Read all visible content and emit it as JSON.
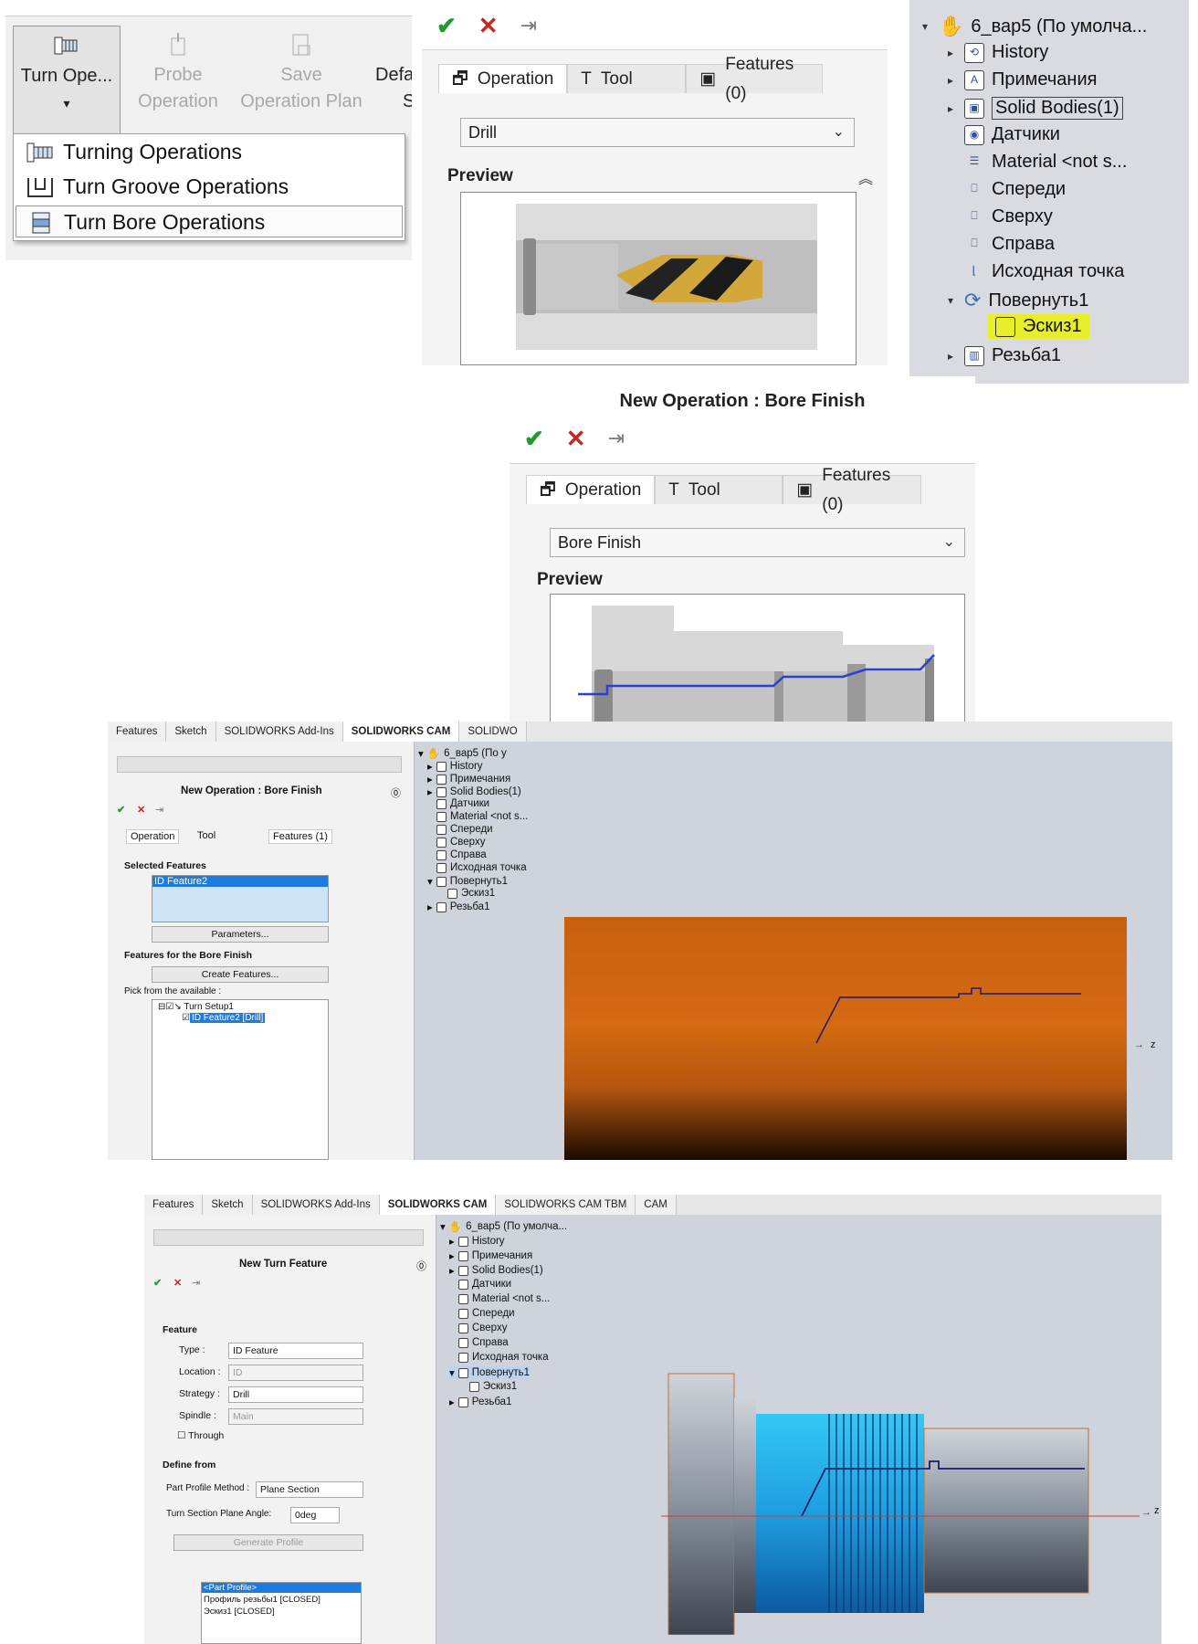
{
  "ribbon": {
    "buttons": [
      {
        "label": "Turn Ope...",
        "arrow": "▾"
      },
      {
        "label_line1": "Probe",
        "label_line2": "Operation"
      },
      {
        "label_line1": "Save",
        "label_line2": "Operation Plan"
      },
      {
        "label_line1": "Defa",
        "label_line2": "S"
      }
    ],
    "menu": [
      "Turning Operations",
      "Turn Groove Operations",
      "Turn Bore Operations"
    ]
  },
  "drill_panel": {
    "tabs": [
      "Operation",
      "Tool",
      "Features (0)"
    ],
    "select_value": "Drill",
    "preview_label": "Preview"
  },
  "tree": {
    "items": [
      "6_вар5 (По умолча...",
      "History",
      "Примечания",
      "Solid Bodies(1)",
      "Датчики",
      "Material <not s...",
      "Спереди",
      "Сверху",
      "Справа",
      "Исходная точка",
      "Повернуть1",
      "Эскиз1",
      "Резьба1"
    ]
  },
  "bore_panel": {
    "title": "New Operation : Bore Finish",
    "tabs": [
      "Operation",
      "Tool",
      "Features (0)"
    ],
    "select_value": "Bore Finish",
    "preview_label": "Preview"
  },
  "cam1": {
    "ribbon_tabs": [
      "Features",
      "Sketch",
      "SOLIDWORKS Add-Ins",
      "SOLIDWORKS CAM",
      "SOLIDWO"
    ],
    "title": "New Operation : Bore Finish",
    "tabs": [
      "Operation",
      "Tool",
      "Features (1)"
    ],
    "selected_header": "Selected Features",
    "selected_item": "ID Feature2",
    "parameters_button": "Parameters...",
    "features_header": "Features for the Bore Finish",
    "create_button": "Create Features...",
    "pick_label": "Pick from the available :",
    "setup_node": "Turn Setup1",
    "feature_node": "ID Feature2 [Drill]",
    "tree": [
      "6_вар5 (По у",
      "History",
      "Примечания",
      "Solid Bodies(1)",
      "Датчики",
      "Material <not s...",
      "Спереди",
      "Сверху",
      "Справа",
      "Исходная точка",
      "Повернуть1",
      "Эскиз1",
      "Резьба1"
    ],
    "axis_label": "z"
  },
  "cam2": {
    "ribbon_tabs": [
      "Features",
      "Sketch",
      "SOLIDWORKS Add-Ins",
      "SOLIDWORKS CAM",
      "SOLIDWORKS CAM TBM",
      "CAM"
    ],
    "title": "New Turn Feature",
    "feature_header": "Feature",
    "type_label": "Type :",
    "type_value": "ID Feature",
    "location_label": "Location :",
    "location_value": "ID",
    "strategy_label": "Strategy :",
    "strategy_value": "Drill",
    "spindle_label": "Spindle :",
    "spindle_value": "Main",
    "through_label": "Through",
    "define_header": "Define from",
    "profile_method_label": "Part Profile Method :",
    "profile_method_value": "Plane Section",
    "angle_label": "Turn Section Plane Angle:",
    "angle_value": "0deg",
    "generate_button": "Generate Profile",
    "profiles": [
      "<Part Profile>",
      "Профиль резьбы1 [CLOSED]",
      "Эскиз1 [CLOSED]"
    ],
    "tree": [
      "6_вар5 (По умолча...",
      "History",
      "Примечания",
      "Solid Bodies(1)",
      "Датчики",
      "Material <not s...",
      "Спереди",
      "Сверху",
      "Справа",
      "Исходная точка",
      "Повернуть1",
      "Эскиз1",
      "Резьба1"
    ],
    "axis_label": "z"
  }
}
